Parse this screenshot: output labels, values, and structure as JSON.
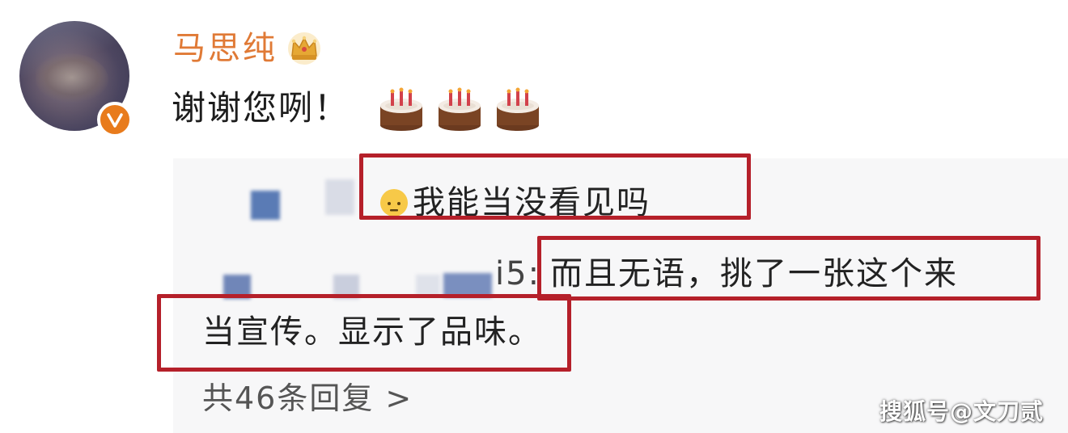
{
  "comment": {
    "author": "马思纯",
    "text": "谢谢您咧！",
    "author_badge_icon": "crown-icon",
    "verified_icon": "verified-v-icon",
    "verified_letter": "v",
    "emoji_icons": [
      "cake-icon",
      "cake-icon",
      "cake-icon"
    ]
  },
  "replies": [
    {
      "emoji_icon": "speechless-face-icon",
      "text": "我能当没看见吗"
    },
    {
      "prefix": "i5: ",
      "text_line1": "而且无语，挑了一张这个来",
      "text_line2": "当宣传。显示了品味。"
    }
  ],
  "more_replies_label": "共46条回复 >",
  "watermark": "搜狐号@文刀贰",
  "colors": {
    "username": "#e07a36",
    "highlight_box": "#b5202a",
    "verified_badge": "#e87b1c",
    "reply_panel_bg": "#f7f7f8"
  }
}
